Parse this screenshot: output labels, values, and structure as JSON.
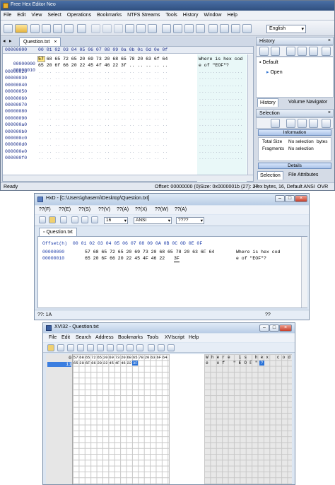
{
  "w1": {
    "title": "Free Hex Editor Neo",
    "menu": [
      "File",
      "Edit",
      "View",
      "Select",
      "Operations",
      "Bookmarks",
      "NTFS Streams",
      "Tools",
      "History",
      "Window",
      "Help"
    ],
    "encoding": "English",
    "tab": "Question.txt",
    "header_offset": "00000000",
    "header_cols": "00 01 02 03 04 05 06 07 08 09 0a 0b 0c 0d 0e 0f",
    "rows": [
      {
        "off": "00000000",
        "hex": "57 68 65 72 65 20 69 73 20 68 65 78 20 63 6f 64",
        "txt": "Where is hex cod"
      },
      {
        "off": "00000010",
        "hex": "65 20 6f 66 20 22 45 4f 46 22 3f",
        "txt": "e of \"EOF\"?"
      }
    ],
    "empty_offsets": [
      "00000020",
      "00000030",
      "00000040",
      "00000050",
      "00000060",
      "00000070",
      "00000080",
      "00000090",
      "000000a0",
      "000000b0",
      "000000c0",
      "000000d0",
      "000000e0",
      "000000f0"
    ],
    "history_title": "History",
    "history_items": [
      "Default",
      "Open"
    ],
    "history_tabs": [
      "History",
      "Volume Navigator"
    ],
    "selection_title": "Selection",
    "info_button": "Information",
    "info_rows": [
      [
        "Total Size",
        "No selection",
        "bytes"
      ],
      [
        "Fragments",
        "No selection",
        ""
      ]
    ],
    "details_button": "Details",
    "sel_tabs": [
      "Selection",
      "File Attributes"
    ],
    "status": {
      "left": "Ready",
      "offset": "Offset: 00000000 (0)",
      "size": "Size: 0x0000001b (27): 27",
      "mode": "Hex bytes, 16, Default ANSI",
      "ovr": "OVR"
    }
  },
  "w2": {
    "title": "HxD - [C:\\Users\\ghasemi\\Desktop\\Question.txt]",
    "menu": [
      "??(F)",
      "??(E)",
      "??(S)",
      "??(V)",
      "??(A)",
      "??(X)",
      "??(W)",
      "??(A)"
    ],
    "cols_value": "16",
    "charset": "ANSI",
    "mode": "????",
    "tab": "Question.txt",
    "header": "Offset(h)  00 01 02 03 04 05 06 07 08 09 0A 0B 0C 0D 0E 0F",
    "rows": [
      {
        "off": "00000000",
        "hex": "57 68 65 72 65 20 69 73 20 68 65 78 20 63 6F 64",
        "txt": "Where is hex cod"
      },
      {
        "off": "00000010",
        "hex": "65 20 6F 66 20 22 45 4F 46 22",
        "last": "3F",
        "txt": "e of \"EOF\"?"
      }
    ],
    "status_left": "??: 1A",
    "status_right": "??"
  },
  "w3": {
    "title": "XVI32 - Question.txt",
    "menu": [
      "File",
      "Edit",
      "Search",
      "Address",
      "Bookmarks",
      "Tools",
      "XVIscript",
      "Help"
    ],
    "rows": [
      {
        "off": "0",
        "hex": [
          "57",
          "68",
          "65",
          "72",
          "65",
          "20",
          "69",
          "73",
          "20",
          "68",
          "65",
          "78",
          "20",
          "63",
          "6F",
          "64"
        ],
        "txt": [
          "W",
          "h",
          "e",
          "r",
          "e",
          "",
          "i",
          "s",
          "",
          "h",
          "e",
          "x",
          "",
          "c",
          "o",
          "d"
        ]
      },
      {
        "off": "11",
        "hex": [
          "65",
          "20",
          "6F",
          "66",
          "20",
          "22",
          "45",
          "4F",
          "46",
          "22",
          "3F"
        ],
        "txt": [
          "e",
          "",
          "o",
          "f",
          "",
          "\"",
          "E",
          "O",
          "F",
          "\"",
          "?"
        ]
      }
    ]
  }
}
